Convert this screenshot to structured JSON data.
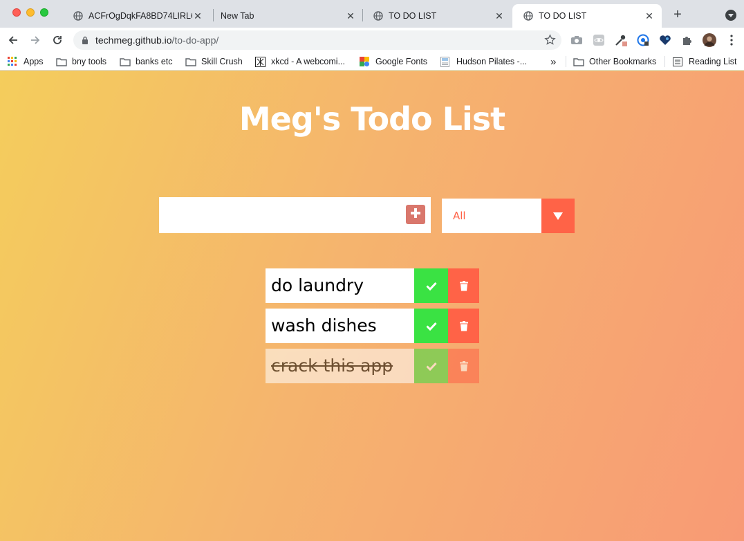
{
  "browser": {
    "tabs": [
      {
        "title": "ACFrOgDqkFA8BD74LIRL6",
        "active": false
      },
      {
        "title": "New Tab",
        "active": false
      },
      {
        "title": "TO DO LIST",
        "active": false
      },
      {
        "title": "TO DO LIST",
        "active": true
      }
    ],
    "new_tab_label": "+",
    "url_host": "techmeg.github.io",
    "url_path": "/to-do-app/",
    "bookmarks": [
      {
        "label": "Apps",
        "icon": "apps-grid-icon"
      },
      {
        "label": "bny tools",
        "icon": "folder-icon"
      },
      {
        "label": "banks etc",
        "icon": "folder-icon"
      },
      {
        "label": "Skill Crush",
        "icon": "folder-icon"
      },
      {
        "label": "xkcd - A webcomi...",
        "icon": "xkcd-icon"
      },
      {
        "label": "Google Fonts",
        "icon": "google-fonts-icon"
      },
      {
        "label": "Hudson Pilates -...",
        "icon": "page-icon"
      }
    ],
    "overflow_label": "»",
    "other_bookmarks": "Other Bookmarks",
    "reading_list": "Reading List"
  },
  "app": {
    "title": "Meg's Todo List",
    "input": {
      "value": "",
      "placeholder": ""
    },
    "filter": {
      "selected": "All"
    },
    "todos": [
      {
        "text": "do laundry",
        "completed": false
      },
      {
        "text": "wash dishes",
        "completed": false
      },
      {
        "text": "crack this app",
        "completed": true
      }
    ]
  },
  "colors": {
    "accent": "#ff6347",
    "check": "#3ae243",
    "add_button": "#d9776c"
  }
}
